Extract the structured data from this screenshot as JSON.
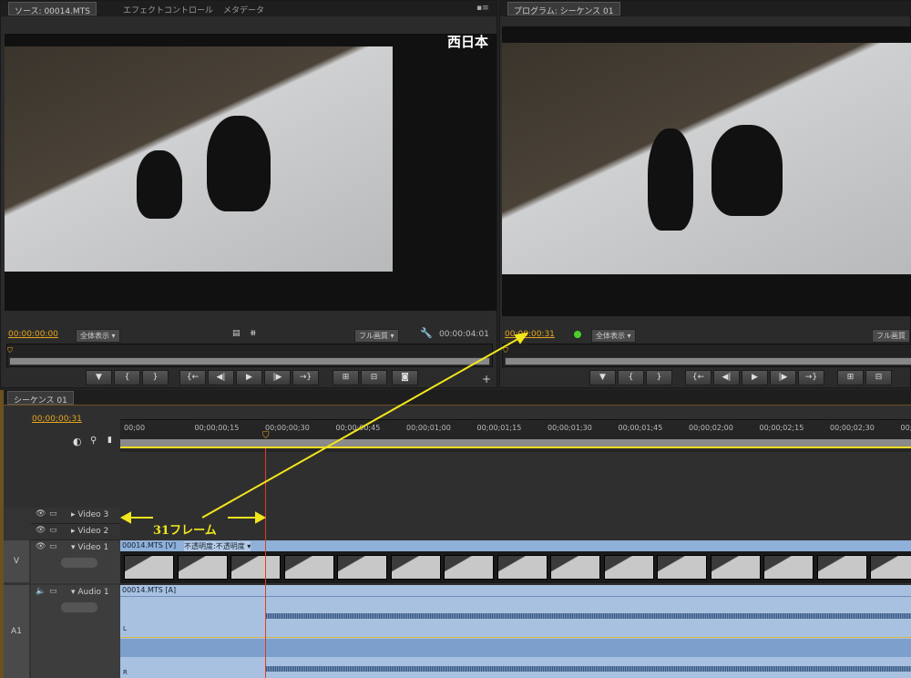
{
  "source": {
    "tab": "ソース: 00014.MTS",
    "tab2": "エフェクトコントロール",
    "tab3": "メタデータ",
    "overlay": "西日本",
    "timecode": "00:00:00:00",
    "zoom": "全体表示",
    "quality": "フル画質",
    "duration": "00:00:04:01"
  },
  "program": {
    "tab": "プログラム: シーケンス 01",
    "timecode": "00:00:00:31",
    "zoom": "全体表示",
    "quality": "フル画質"
  },
  "timeline": {
    "tab": "シーケンス 01",
    "timecode": "00;00;00;31",
    "ruler": [
      "00;00",
      "00;00;00;15",
      "00;00;00;30",
      "00;00;00;45",
      "00;00;01;00",
      "00;00;01;15",
      "00;00;01;30",
      "00;00;01;45",
      "00;00;02;00",
      "00;00;02;15",
      "00;00;02;30",
      "00;00;02;"
    ],
    "tracks": {
      "v3": "Video 3",
      "v2": "Video 2",
      "v1": "Video 1",
      "a1": "Audio 1",
      "v_label": "V",
      "a_label": "A1"
    },
    "video_clip": "00014.MTS [V]",
    "opacity": "不透明度:不透明度",
    "audio_clip": "00014.MTS [A]",
    "ch_l": "L",
    "ch_r": "R"
  },
  "annotation": {
    "text": "31フレーム",
    "color": "#f2e61c"
  }
}
